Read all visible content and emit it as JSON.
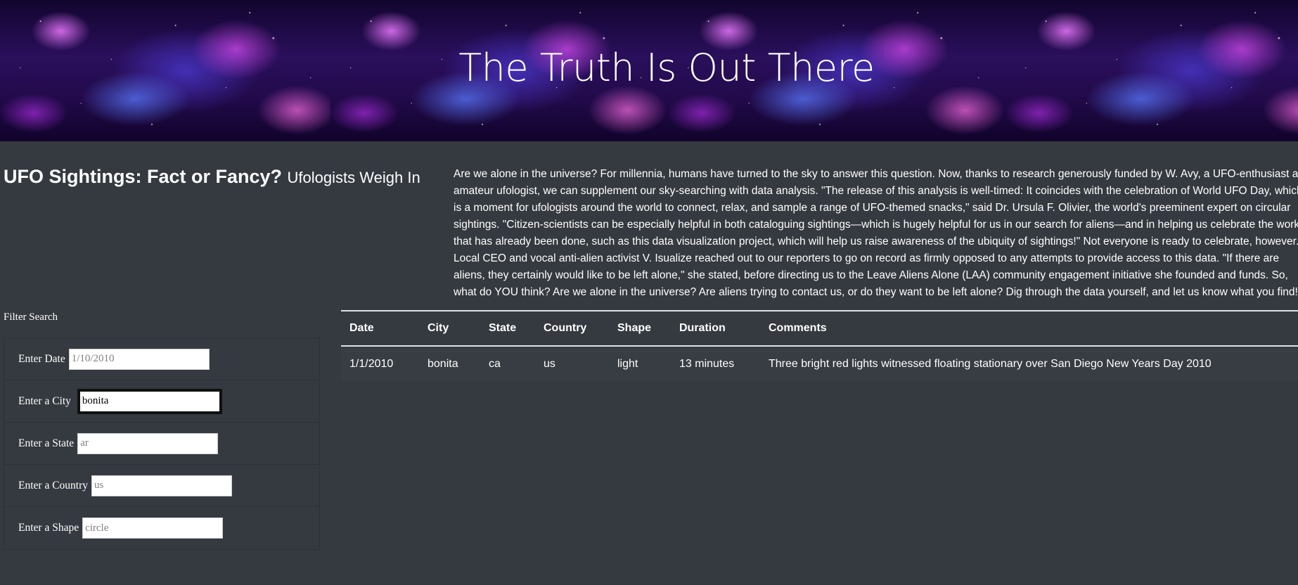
{
  "banner": {
    "title": "The Truth Is Out There"
  },
  "heading": {
    "title": "UFO Sightings: Fact or Fancy?",
    "subtitle": "Ufologists Weigh In"
  },
  "intro": {
    "lines": [
      "Are we alone in the universe? For millennia, humans have turned to the sky to answer this question. Now, thanks to research generously funded by W. Avy, a UFO-enthusiast and",
      "amateur ufologist, we can supplement our sky-searching with data analysis. \"The release of this analysis is well-timed: It coincides with the celebration of World UFO Day, which",
      "is a moment for ufologists around the world to connect, relax, and sample a range of UFO-themed snacks,\" said Dr. Ursula F. Olivier, the world's preeminent expert on circular",
      "sightings. \"Citizen-scientists can be especially helpful in both cataloguing sightings—which is hugely helpful for us in our search for aliens—and in helping us celebrate the work",
      "that has already been done, such as this data visualization project, which will help us raise awareness of the ubiquity of sightings!\" Not everyone is ready to celebrate, however.",
      "Local CEO and vocal anti-alien activist V. Isualize reached out to our reporters to go on record as firmly opposed to any attempts to provide access to this data. \"If there are",
      "aliens, they certainly would like to be left alone,\" she stated, before directing us to the Leave Aliens Alone (LAA) community engagement initiative she founded and funds. So,",
      "what do YOU think? Are we alone in the universe? Are aliens trying to contact us, or do they want to be left alone? Dig through the data yourself, and let us know what you find!"
    ]
  },
  "filters": {
    "title": "Filter Search",
    "fields": [
      {
        "label": "Enter Date",
        "value": "",
        "placeholder": "1/10/2010"
      },
      {
        "label": "Enter a City",
        "value": "bonita",
        "placeholder": ""
      },
      {
        "label": "Enter a State",
        "value": "",
        "placeholder": "ar"
      },
      {
        "label": "Enter a Country",
        "value": "",
        "placeholder": "us"
      },
      {
        "label": "Enter a Shape",
        "value": "",
        "placeholder": "circle"
      }
    ]
  },
  "table": {
    "headers": [
      "Date",
      "City",
      "State",
      "Country",
      "Shape",
      "Duration",
      "Comments"
    ],
    "rows": [
      [
        "1/1/2010",
        "bonita",
        "ca",
        "us",
        "light",
        "13 minutes",
        "Three bright red lights witnessed floating stationary over San Diego New Years Day 2010"
      ]
    ]
  }
}
